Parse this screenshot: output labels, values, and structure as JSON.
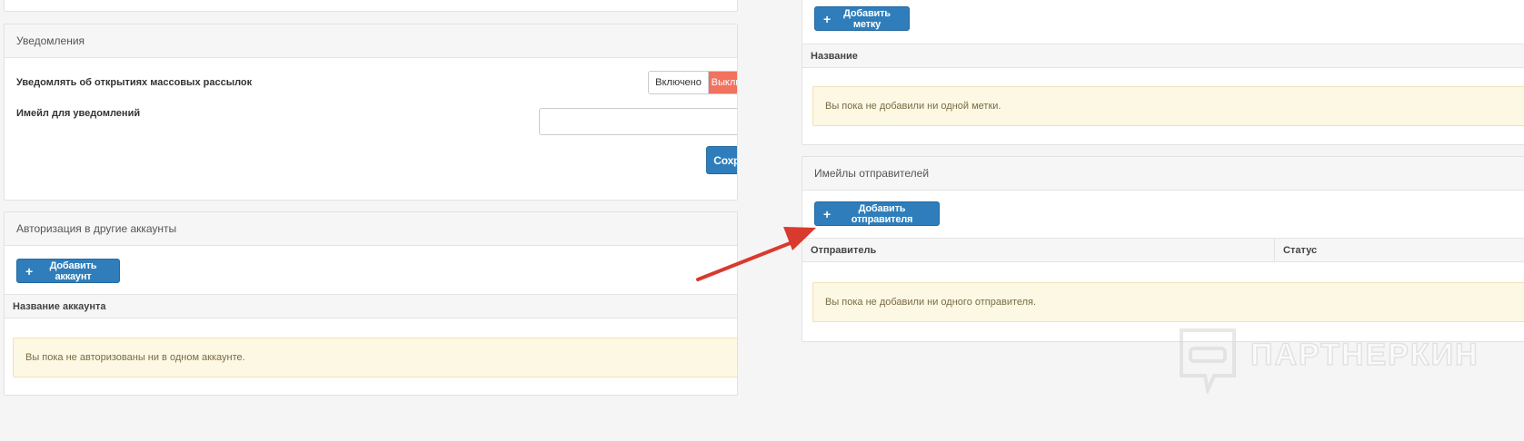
{
  "notifications": {
    "title": "Уведомления",
    "open_notify_label": "Уведомлять об открытиях массовых рассылок",
    "toggle_on": "Включено",
    "toggle_off": "Выключено",
    "email_label": "Имейл для уведомлений",
    "email_value": "",
    "save_label": "Сохранить"
  },
  "auth": {
    "title": "Авторизация в другие аккаунты",
    "add_label": "Добавить аккаунт",
    "col_account": "Название аккаунта",
    "empty": "Вы пока не авторизованы ни в одном аккаунте."
  },
  "tags": {
    "add_label": "Добавить метку",
    "col_name": "Название",
    "empty": "Вы пока не добавили ни одной метки."
  },
  "senders": {
    "title": "Имейлы отправителей",
    "add_label": "Добавить отправителя",
    "col_sender": "Отправитель",
    "col_status": "Статус",
    "empty": "Вы пока не добавили ни одного отправителя."
  },
  "watermark": {
    "text": "ПАРТНЕРКИН"
  },
  "colors": {
    "primary": "#2f7ebb",
    "toggle_off": "#f0725f",
    "arrow": "#d93a2e"
  }
}
